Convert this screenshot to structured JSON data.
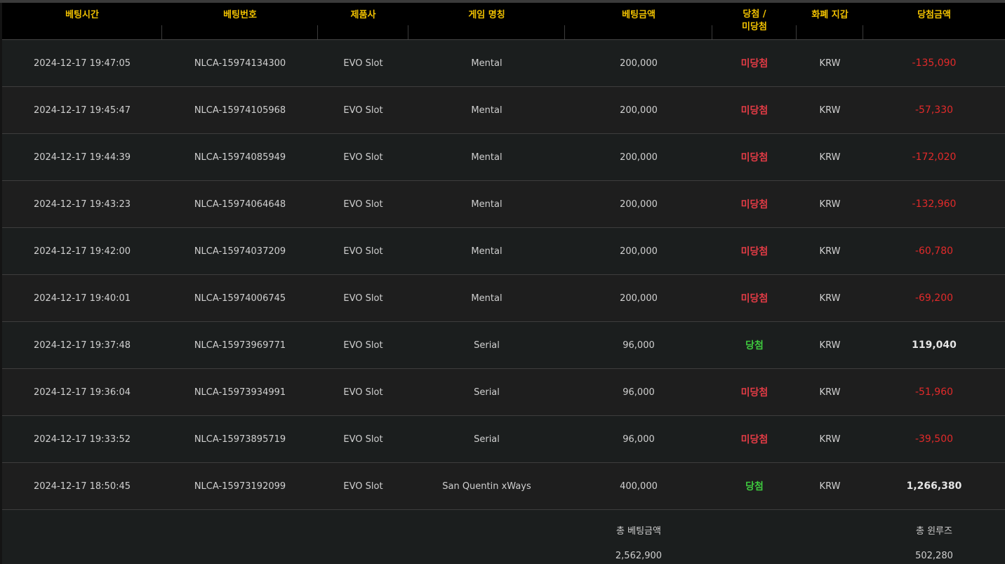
{
  "headers": {
    "time": "베팅시간",
    "bet_no": "베팅번호",
    "provider": "제품사",
    "game": "게임 명칭",
    "bet_amount": "베팅금액",
    "result_line1": "당첨 /",
    "result_line2": "미당첨",
    "wallet": "화폐 지갑",
    "win_amount": "당첨금액"
  },
  "rows": [
    {
      "time": "2024-12-17 19:47:05",
      "bet_no": "NLCA-15974134300",
      "provider": "EVO Slot",
      "game": "Mental",
      "bet": "200,000",
      "status": "미당첨",
      "wallet": "KRW",
      "win": "-135,090"
    },
    {
      "time": "2024-12-17 19:45:47",
      "bet_no": "NLCA-15974105968",
      "provider": "EVO Slot",
      "game": "Mental",
      "bet": "200,000",
      "status": "미당첨",
      "wallet": "KRW",
      "win": "-57,330"
    },
    {
      "time": "2024-12-17 19:44:39",
      "bet_no": "NLCA-15974085949",
      "provider": "EVO Slot",
      "game": "Mental",
      "bet": "200,000",
      "status": "미당첨",
      "wallet": "KRW",
      "win": "-172,020"
    },
    {
      "time": "2024-12-17 19:43:23",
      "bet_no": "NLCA-15974064648",
      "provider": "EVO Slot",
      "game": "Mental",
      "bet": "200,000",
      "status": "미당첨",
      "wallet": "KRW",
      "win": "-132,960"
    },
    {
      "time": "2024-12-17 19:42:00",
      "bet_no": "NLCA-15974037209",
      "provider": "EVO Slot",
      "game": "Mental",
      "bet": "200,000",
      "status": "미당첨",
      "wallet": "KRW",
      "win": "-60,780"
    },
    {
      "time": "2024-12-17 19:40:01",
      "bet_no": "NLCA-15974006745",
      "provider": "EVO Slot",
      "game": "Mental",
      "bet": "200,000",
      "status": "미당첨",
      "wallet": "KRW",
      "win": "-69,200"
    },
    {
      "time": "2024-12-17 19:37:48",
      "bet_no": "NLCA-15973969771",
      "provider": "EVO Slot",
      "game": "Serial",
      "bet": "96,000",
      "status": "당첨",
      "wallet": "KRW",
      "win": "119,040"
    },
    {
      "time": "2024-12-17 19:36:04",
      "bet_no": "NLCA-15973934991",
      "provider": "EVO Slot",
      "game": "Serial",
      "bet": "96,000",
      "status": "미당첨",
      "wallet": "KRW",
      "win": "-51,960"
    },
    {
      "time": "2024-12-17 19:33:52",
      "bet_no": "NLCA-15973895719",
      "provider": "EVO Slot",
      "game": "Serial",
      "bet": "96,000",
      "status": "미당첨",
      "wallet": "KRW",
      "win": "-39,500"
    },
    {
      "time": "2024-12-17 18:50:45",
      "bet_no": "NLCA-15973192099",
      "provider": "EVO Slot",
      "game": "San Quentin xWays",
      "bet": "400,000",
      "status": "당첨",
      "wallet": "KRW",
      "win": "1,266,380"
    }
  ],
  "totals": {
    "bet_label": "총 베팅금액",
    "bet_value": "2,562,900",
    "winloss_label": "총 윈루즈",
    "winloss_value": "502,280"
  },
  "colors": {
    "header_text": "#f2c200",
    "lose": "#e23b45",
    "win": "#3ec93e",
    "negative_amount": "#e22a2a"
  }
}
